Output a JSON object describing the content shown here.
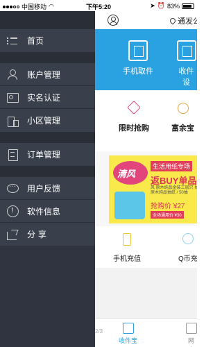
{
  "status_bar": {
    "carrier": "中国移动",
    "time": "下午5:20",
    "battery": "83%"
  },
  "drawer": {
    "groups": [
      [
        {
          "label": "首页",
          "icon": "list-icon"
        }
      ],
      [
        {
          "label": "账户管理",
          "icon": "user-icon"
        },
        {
          "label": "实名认证",
          "icon": "id-card-icon"
        },
        {
          "label": "小区管理",
          "icon": "building-icon"
        }
      ],
      [
        {
          "label": "订单管理",
          "icon": "document-icon"
        }
      ],
      [
        {
          "label": "用户反馈",
          "icon": "chat-icon"
        },
        {
          "label": "软件信息",
          "icon": "info-icon"
        },
        {
          "label": "分 享",
          "icon": "share-icon"
        }
      ]
    ]
  },
  "app": {
    "header": {
      "location": "通发公"
    },
    "banner": [
      {
        "label": "手机取件"
      },
      {
        "label": "收件设"
      }
    ],
    "promos": [
      {
        "label": "限时抢购"
      },
      {
        "label": "富余宝"
      }
    ],
    "ad": {
      "brand": "清风",
      "title": "生活用纸专场",
      "buy": "返BUY单品",
      "desc": "风 原木纯品金装三层只 抽原木纯品抽纸 / 50抽",
      "price": "抢购价 ¥27",
      "footer": "全场通用价 ¥30"
    },
    "services": [
      {
        "label": "手机充值"
      },
      {
        "label": "Q币充"
      }
    ],
    "page_indicator": "2/3",
    "tabs": [
      {
        "label": "收件宝",
        "active": true
      },
      {
        "label": "网店"
      }
    ]
  },
  "colors": {
    "drawer_bg": "#2f3440",
    "accent": "#2aa1e0"
  }
}
